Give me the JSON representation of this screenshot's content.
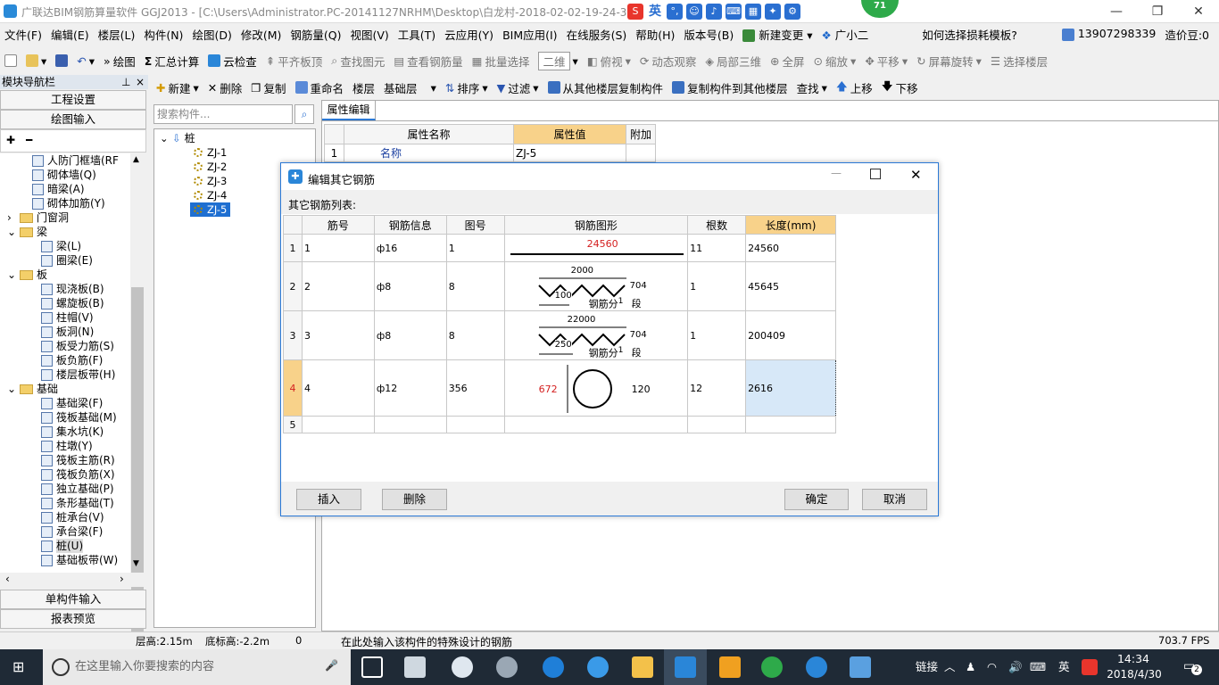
{
  "title": "广联达BIM钢筋算量软件 GGJ2013 - [C:\\Users\\Administrator.PC-20141127NRHM\\Desktop\\白龙村-2018-02-02-19-24-35",
  "ime": [
    "英"
  ],
  "badge": "71",
  "menu": [
    "文件(F)",
    "编辑(E)",
    "楼层(L)",
    "构件(N)",
    "绘图(D)",
    "修改(M)",
    "钢筋量(Q)",
    "视图(V)",
    "工具(T)",
    "云应用(Y)",
    "BIM应用(I)",
    "在线服务(S)",
    "帮助(H)",
    "版本号(B)",
    "新建变更",
    "广小二"
  ],
  "menu_right": {
    "hint": "如何选择损耗模板?",
    "phone": "13907298339",
    "price": "造价豆:0"
  },
  "toolbar1": [
    "绘图",
    "汇总计算",
    "云检查",
    "平齐板顶",
    "查找图元",
    "查看钢筋量",
    "批量选择",
    "二维",
    "俯视",
    "动态观察",
    "局部三维",
    "全屏",
    "缩放",
    "平移",
    "屏幕旋转",
    "选择楼层"
  ],
  "toolbar2": [
    "新建",
    "删除",
    "复制",
    "重命名",
    "楼层",
    "基础层",
    "排序",
    "过滤",
    "从其他楼层复制构件",
    "复制构件到其他楼层",
    "查找",
    "上移",
    "下移"
  ],
  "nav": {
    "title": "模块导航栏",
    "top_buttons": [
      "工程设置",
      "绘图输入"
    ],
    "bottom_buttons": [
      "单构件输入",
      "报表预览"
    ]
  },
  "tree": [
    {
      "label": "人防门框墙(RF",
      "indent": 2,
      "type": "item"
    },
    {
      "label": "砌体墙(Q)",
      "indent": 2,
      "type": "item"
    },
    {
      "label": "暗梁(A)",
      "indent": 2,
      "type": "item"
    },
    {
      "label": "砌体加筋(Y)",
      "indent": 2,
      "type": "item"
    },
    {
      "label": "门窗洞",
      "indent": 1,
      "type": "folder",
      "exp": "›"
    },
    {
      "label": "梁",
      "indent": 1,
      "type": "folder",
      "exp": "⌄"
    },
    {
      "label": "梁(L)",
      "indent": 2,
      "type": "item"
    },
    {
      "label": "圈梁(E)",
      "indent": 2,
      "type": "item"
    },
    {
      "label": "板",
      "indent": 1,
      "type": "folder",
      "exp": "⌄"
    },
    {
      "label": "现浇板(B)",
      "indent": 2,
      "type": "item"
    },
    {
      "label": "螺旋板(B)",
      "indent": 2,
      "type": "item"
    },
    {
      "label": "柱帽(V)",
      "indent": 2,
      "type": "item"
    },
    {
      "label": "板洞(N)",
      "indent": 2,
      "type": "item"
    },
    {
      "label": "板受力筋(S)",
      "indent": 2,
      "type": "item"
    },
    {
      "label": "板负筋(F)",
      "indent": 2,
      "type": "item"
    },
    {
      "label": "楼层板带(H)",
      "indent": 2,
      "type": "item"
    },
    {
      "label": "基础",
      "indent": 1,
      "type": "folder",
      "exp": "⌄"
    },
    {
      "label": "基础梁(F)",
      "indent": 2,
      "type": "item"
    },
    {
      "label": "筏板基础(M)",
      "indent": 2,
      "type": "item"
    },
    {
      "label": "集水坑(K)",
      "indent": 2,
      "type": "item"
    },
    {
      "label": "柱墩(Y)",
      "indent": 2,
      "type": "item"
    },
    {
      "label": "筏板主筋(R)",
      "indent": 2,
      "type": "item"
    },
    {
      "label": "筏板负筋(X)",
      "indent": 2,
      "type": "item"
    },
    {
      "label": "独立基础(P)",
      "indent": 2,
      "type": "item"
    },
    {
      "label": "条形基础(T)",
      "indent": 2,
      "type": "item"
    },
    {
      "label": "桩承台(V)",
      "indent": 2,
      "type": "item"
    },
    {
      "label": "承台梁(F)",
      "indent": 2,
      "type": "item"
    },
    {
      "label": "桩(U)",
      "indent": 2,
      "type": "item",
      "selected": true
    },
    {
      "label": "基础板带(W)",
      "indent": 2,
      "type": "item"
    }
  ],
  "search": {
    "placeholder": "搜索构件..."
  },
  "components": {
    "root": "桩",
    "items": [
      "ZJ-1",
      "ZJ-2",
      "ZJ-3",
      "ZJ-4",
      "ZJ-5"
    ],
    "selected": "ZJ-5"
  },
  "props": {
    "tab": "属性编辑",
    "headers": [
      "属性名称",
      "属性值",
      "附加"
    ],
    "row": {
      "num": "1",
      "name": "名称",
      "value": "ZJ-5"
    }
  },
  "dialog": {
    "title": "编辑其它钢筋",
    "list_label": "其它钢筋列表:",
    "headers": [
      "筋号",
      "钢筋信息",
      "图号",
      "钢筋图形",
      "根数",
      "长度(mm)"
    ],
    "rows": [
      {
        "n": "1",
        "jh": "1",
        "info": "ф16",
        "th": "1",
        "count": "11",
        "len": "24560"
      },
      {
        "n": "2",
        "jh": "2",
        "info": "ф8",
        "th": "8",
        "count": "1",
        "len": "45645"
      },
      {
        "n": "3",
        "jh": "3",
        "info": "ф8",
        "th": "8",
        "count": "1",
        "len": "200409"
      },
      {
        "n": "4",
        "jh": "4",
        "info": "ф12",
        "th": "356",
        "count": "12",
        "len": "2616"
      },
      {
        "n": "5",
        "jh": "",
        "info": "",
        "th": "",
        "count": "",
        "len": ""
      }
    ],
    "shape1": {
      "value": "24560"
    },
    "shape2": {
      "top": "2000",
      "left": "100",
      "right": "704",
      "label": "钢筋分",
      "sup": "1",
      "seg": "段"
    },
    "shape3": {
      "top": "22000",
      "left": "250",
      "right": "704",
      "label": "钢筋分",
      "sup": "1",
      "seg": "段"
    },
    "shape4": {
      "left": "672",
      "right": "120"
    },
    "buttons": {
      "insert": "插入",
      "delete": "删除",
      "ok": "确定",
      "cancel": "取消"
    }
  },
  "status": {
    "floor_h": "层高:2.15m",
    "base_h": "底标高:-2.2m",
    "zero": "0",
    "msg": "在此处输入该构件的特殊设计的钢筋",
    "fps": "703.7 FPS"
  },
  "taskbar": {
    "search": "在这里输入你要搜索的内容",
    "link": "链接",
    "ime": "英",
    "time": "14:34",
    "date": "2018/4/30",
    "notif": "2"
  }
}
